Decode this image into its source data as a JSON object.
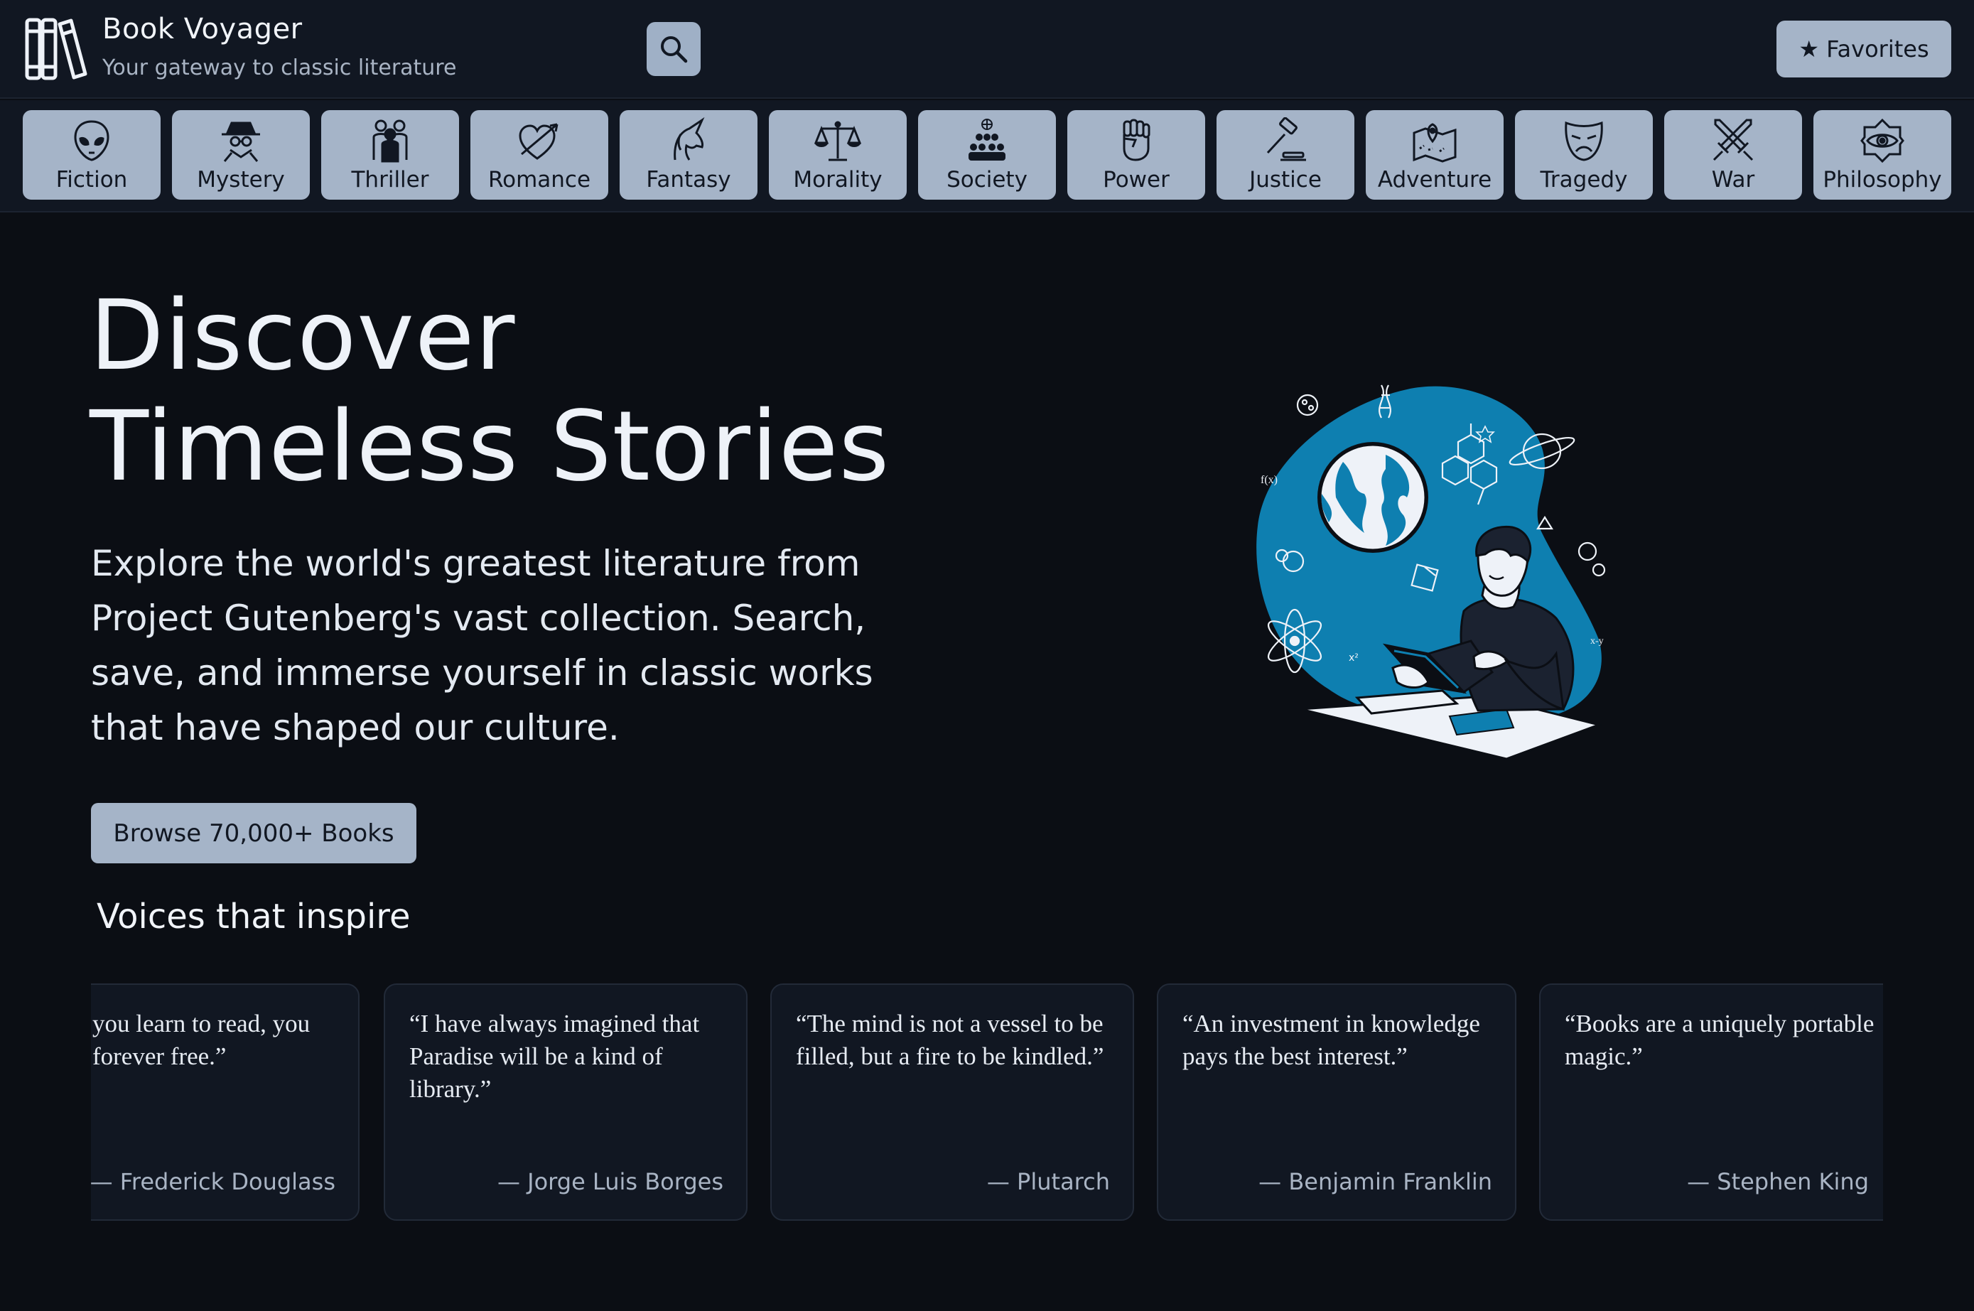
{
  "header": {
    "title": "Book Voyager",
    "subtitle": "Your gateway to classic literature",
    "search_icon": "search-icon",
    "favorites_label": "Favorites",
    "favorites_icon": "★"
  },
  "categories": [
    {
      "label": "Fiction",
      "icon": "alien-icon"
    },
    {
      "label": "Mystery",
      "icon": "spy-icon"
    },
    {
      "label": "Thriller",
      "icon": "silhouettes-icon"
    },
    {
      "label": "Romance",
      "icon": "heart-arrow-icon"
    },
    {
      "label": "Fantasy",
      "icon": "unicorn-icon"
    },
    {
      "label": "Morality",
      "icon": "scales-icon"
    },
    {
      "label": "Society",
      "icon": "people-globe-icon"
    },
    {
      "label": "Power",
      "icon": "fist-icon"
    },
    {
      "label": "Justice",
      "icon": "gavel-icon"
    },
    {
      "label": "Adventure",
      "icon": "map-pin-icon"
    },
    {
      "label": "Tragedy",
      "icon": "sad-mask-icon"
    },
    {
      "label": "War",
      "icon": "crossed-swords-icon"
    },
    {
      "label": "Philosophy",
      "icon": "eye-icon"
    }
  ],
  "hero": {
    "title_line1": "Discover",
    "title_line2": "Timeless Stories",
    "description": "Explore the world's greatest literature from Project Gutenberg's vast collection. Search, save, and immerse yourself in classic works that have shaped our culture.",
    "browse_label": "Browse 70,000+ Books",
    "illustration": "person-reading-book-with-globe-illustration"
  },
  "voices": {
    "title": "Voices that inspire",
    "quotes": [
      {
        "text": "you learn to read, you forever free.”",
        "author": "— Frederick Douglass"
      },
      {
        "text": "“I have always imagined that Paradise will be a kind of library.”",
        "author": "— Jorge Luis Borges"
      },
      {
        "text": "“The mind is not a vessel to be filled, but a fire to be kindled.”",
        "author": "— Plutarch"
      },
      {
        "text": "“An investment in knowledge pays the best interest.”",
        "author": "— Benjamin Franklin"
      },
      {
        "text": "“Books are a uniquely portable magic.”",
        "author": "— Stephen King"
      }
    ]
  },
  "colors": {
    "background": "#0b0e14",
    "header_bg": "#111722",
    "button_bg": "#a5b4c8",
    "accent_blue": "#0e7fb0"
  }
}
